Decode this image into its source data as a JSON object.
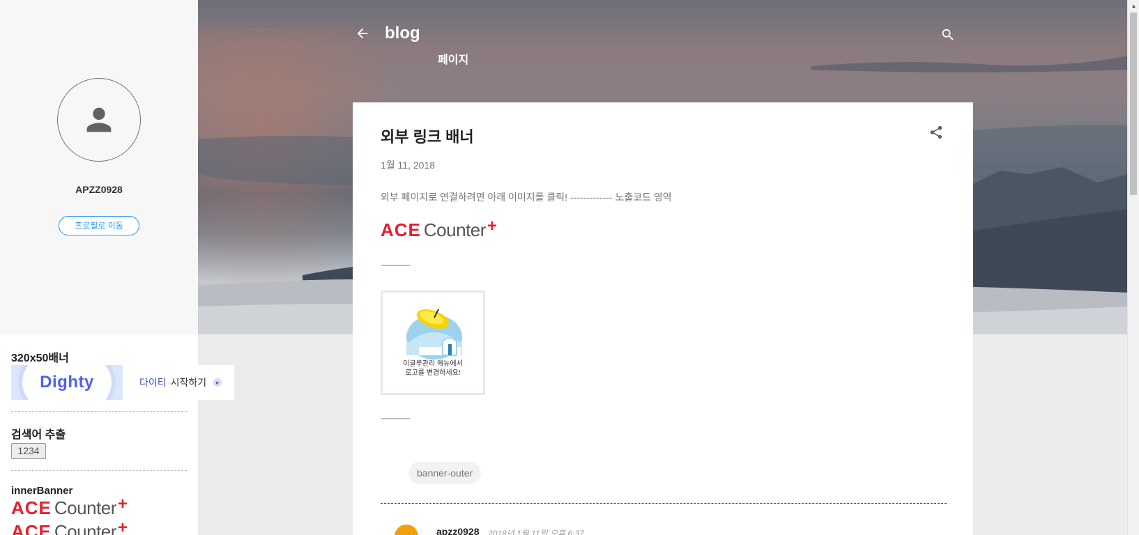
{
  "profile": {
    "name": "APZZ0928",
    "button_label": "프로필로 이동"
  },
  "widgets": {
    "banner": {
      "title": "320x50배너",
      "logo_text": "Dighty",
      "cta_accent": "다이티",
      "cta_text": "시작하기"
    },
    "keyword": {
      "title": "검색어 추출",
      "button_label": "1234"
    },
    "inner_banner": {
      "title": "innerBanner",
      "ace_text": "ACE",
      "counter_text": "Counter",
      "plus_text": "+"
    }
  },
  "header": {
    "blog_title": "blog",
    "subtitle": "페이지"
  },
  "post": {
    "title": "외부 링크 배너",
    "date": "1월 11, 2018",
    "body": "외부 페이지로 연결하려면 아래 이미지를 클릭! ------------- 노출코드 영역",
    "ace_text": "ACE",
    "counter_text": "Counter",
    "plus_text": "+",
    "dashes_top": "--------------",
    "dashes_bottom": "--------------",
    "image_caption_1": "이글루관리 메뉴에서",
    "image_caption_2": "로고를 변경하세요!",
    "label": "banner-outer"
  },
  "comment": {
    "author": "apzz0928",
    "time": "2018년 1월 11일 오후 6:37"
  },
  "icons": {
    "back": "arrow-left-icon",
    "search": "search-icon",
    "share": "share-icon",
    "avatar": "person-icon"
  },
  "colors": {
    "accent_blue": "#2196f3",
    "ace_red": "#e5202e",
    "dighty_blue": "#4f63e6"
  }
}
